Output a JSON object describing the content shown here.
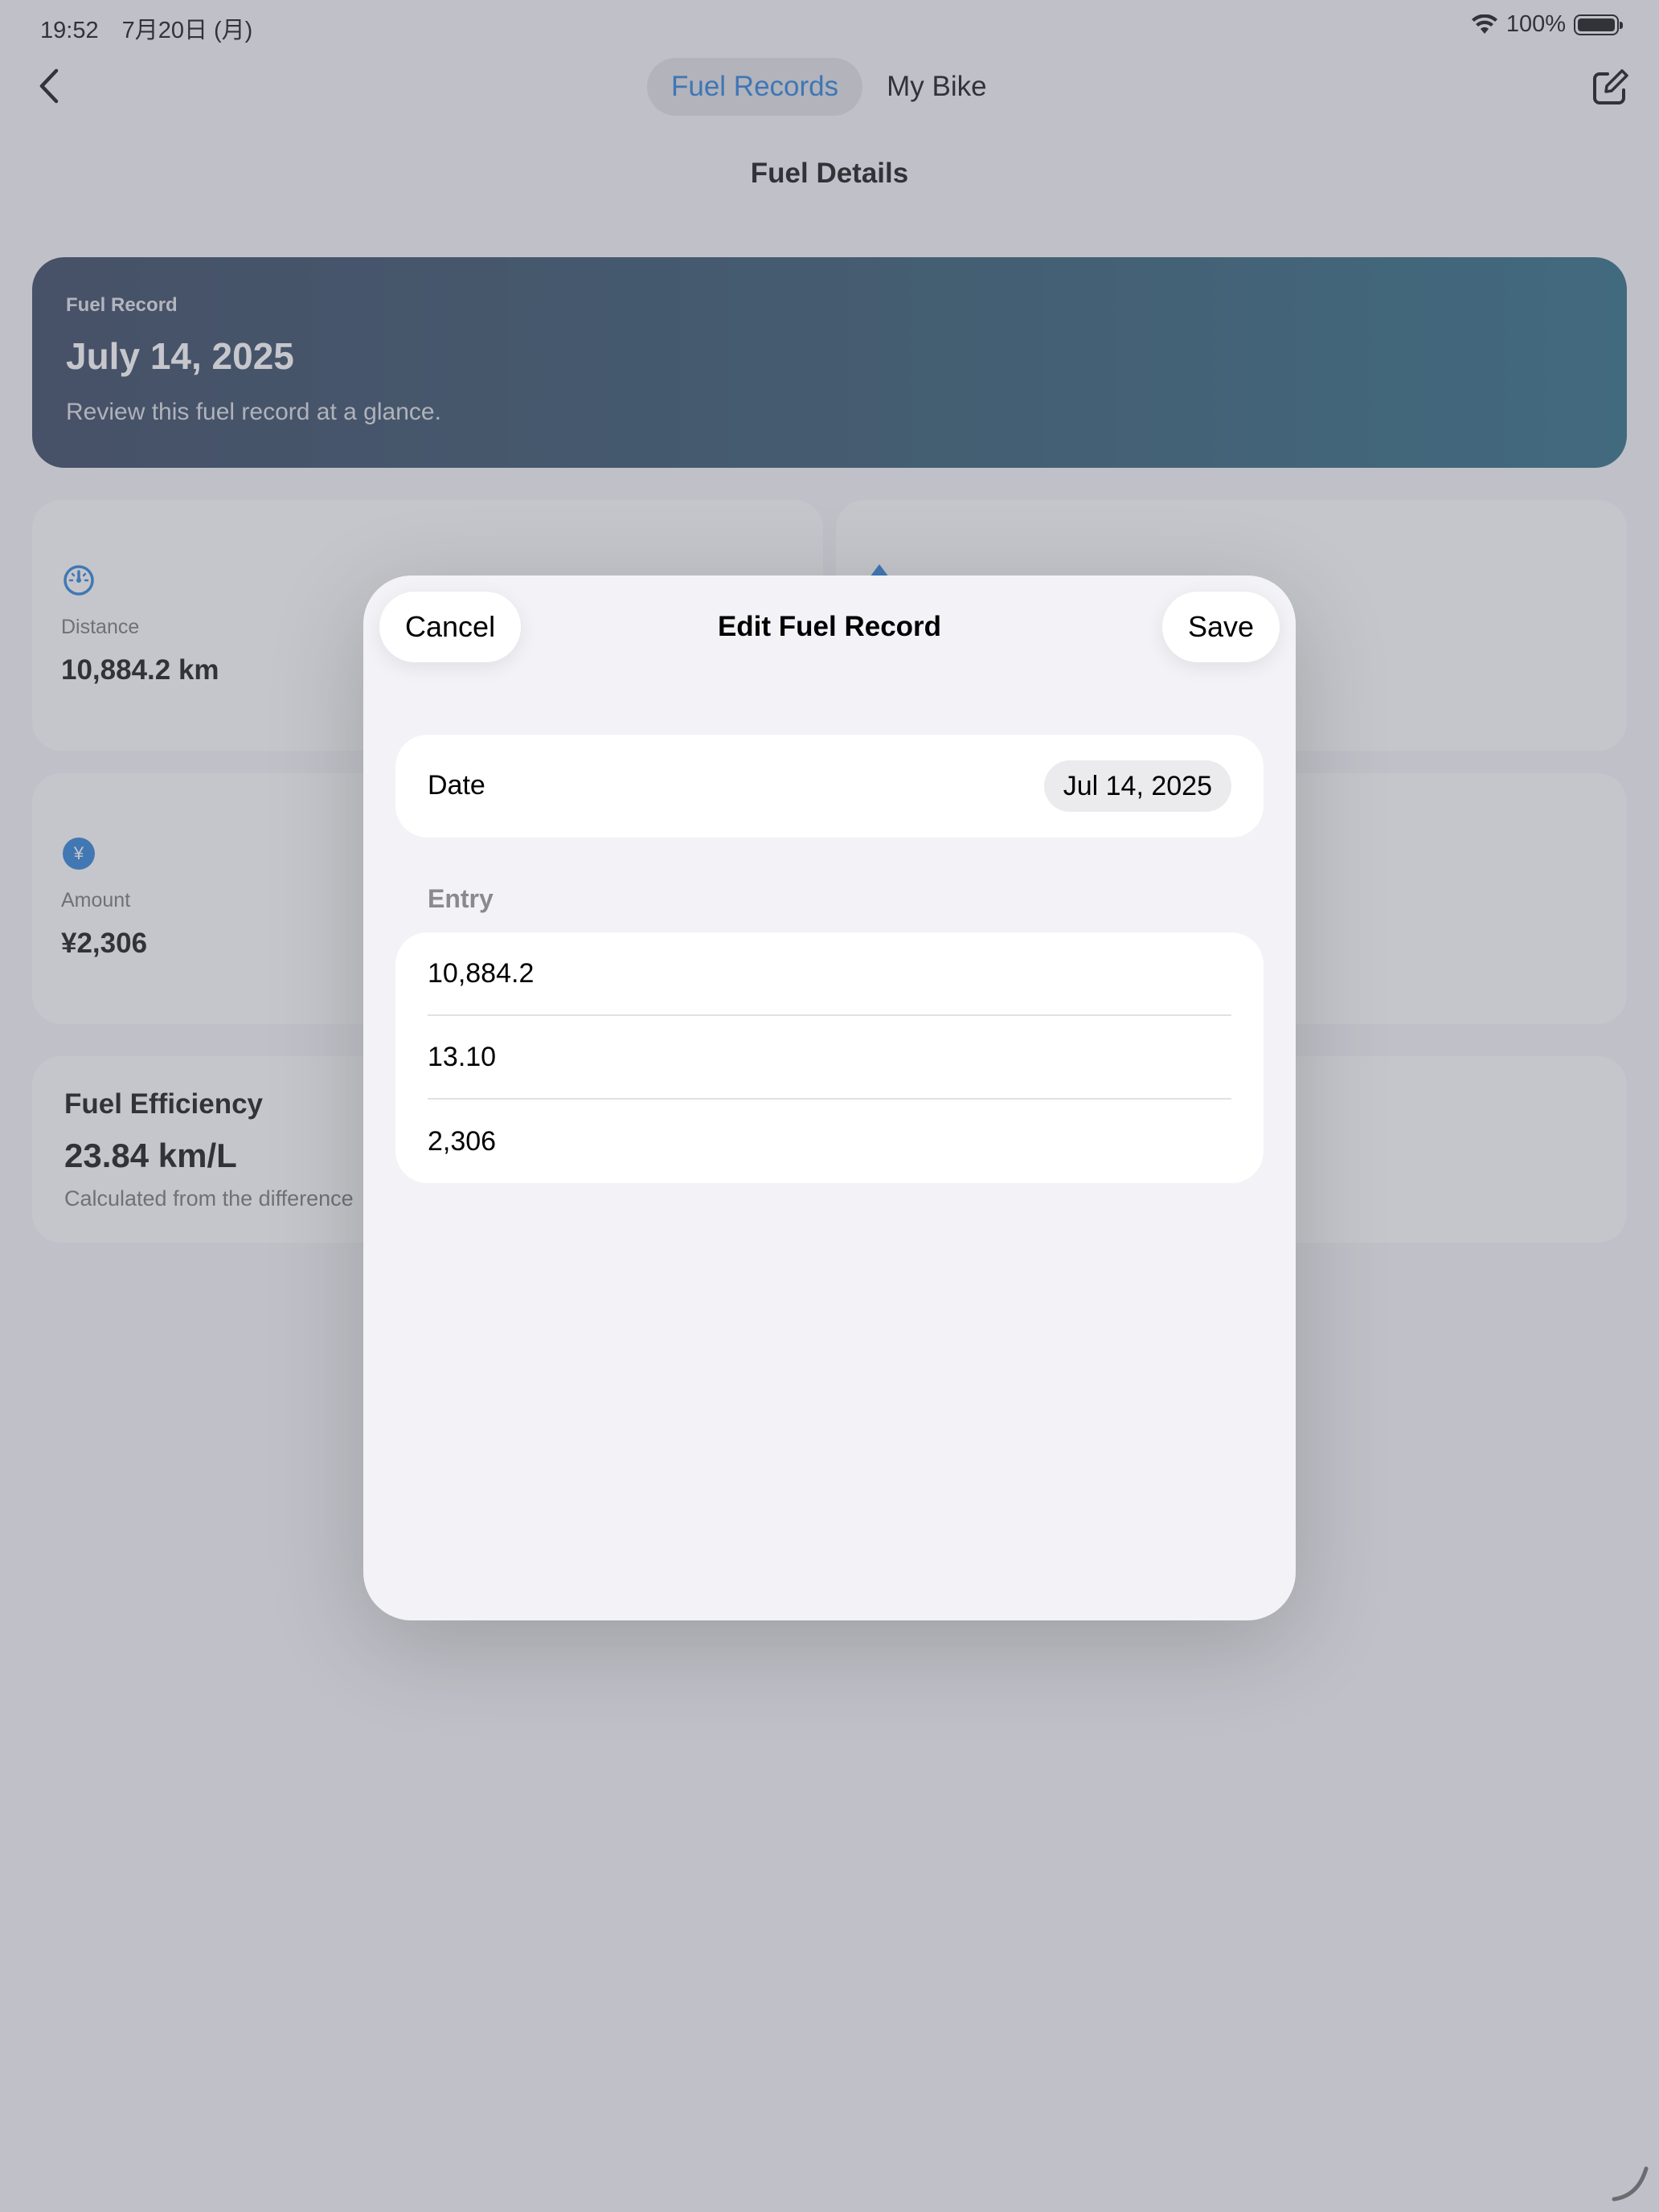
{
  "status": {
    "time": "19:52　7月20日 (月)",
    "battery": "100%"
  },
  "nav": {
    "tabs": [
      {
        "label": "Fuel Records",
        "active": true
      },
      {
        "label": "My Bike",
        "active": false
      }
    ],
    "title": "Fuel Details",
    "back_icon": "chevron-left-icon",
    "compose_icon": "compose-icon"
  },
  "hero": {
    "kicker": "Fuel Record",
    "title": "July 14, 2025",
    "subtitle": "Review this fuel record at a glance.",
    "gradient": [
      "#253452",
      "#1c5f7a"
    ]
  },
  "cards": {
    "distance": {
      "label": "Distance",
      "value": "10,884.2 km",
      "icon": "speedometer-icon"
    },
    "amount": {
      "label": "Amount",
      "value": "¥2,306",
      "icon": "yen-icon",
      "icon_glyph": "¥"
    }
  },
  "efficiency": {
    "title": "Fuel Efficiency",
    "value": "23.84 km/L",
    "note": "Calculated from the difference"
  },
  "modal": {
    "title": "Edit Fuel Record",
    "cancel_label": "Cancel",
    "save_label": "Save",
    "date_label": "Date",
    "date_value": "Jul 14, 2025",
    "section_label": "Entry",
    "fields": [
      "10,884.2",
      "13.10",
      "2,306"
    ]
  },
  "colors": {
    "accent": "#1774d8",
    "dim": "rgba(120,122,133,0.42)"
  }
}
